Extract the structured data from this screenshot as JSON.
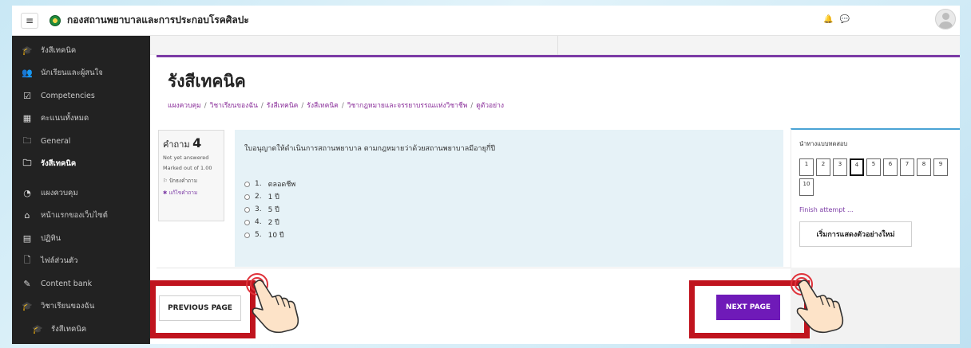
{
  "navbar": {
    "menu_icon": "hamburger-icon",
    "site_name": "กองสถานพยาบาลและการประกอบโรคศิลปะ",
    "notification_icon": "bell-icon",
    "message_icon": "chat-icon"
  },
  "sidebar": {
    "items": [
      {
        "label": "รังสีเทคนิค",
        "icon": "graduation-cap-icon"
      },
      {
        "label": "นักเรียนและผู้สนใจ",
        "icon": "users-icon"
      },
      {
        "label": "Competencies",
        "icon": "checkbox-icon"
      },
      {
        "label": "คะแนนทั้งหมด",
        "icon": "table-icon"
      },
      {
        "label": "General",
        "icon": "folder-icon"
      },
      {
        "label": "รังสีเทคนิค",
        "icon": "folder-icon"
      },
      {
        "label": "แผงควบคุม",
        "icon": "dashboard-icon"
      },
      {
        "label": "หน้าแรกของเว็บไซต์",
        "icon": "home-icon"
      },
      {
        "label": "ปฏิทิน",
        "icon": "calendar-icon"
      },
      {
        "label": "ไฟล์ส่วนตัว",
        "icon": "file-icon"
      },
      {
        "label": "Content bank",
        "icon": "pen-icon"
      },
      {
        "label": "วิชาเรียนของฉัน",
        "icon": "graduation-cap-icon"
      },
      {
        "label": "รังสีเทคนิค",
        "icon": "graduation-cap-icon"
      }
    ]
  },
  "page": {
    "title": "รังสีเทคนิค",
    "breadcrumb": [
      "แผงควบคุม",
      "วิชาเรียนของฉัน",
      "รังสีเทคนิค",
      "รังสีเทคนิค",
      "วิชากฎหมายและจรรยาบรรณแห่งวิชาชีพ",
      "ดูตัวอย่าง"
    ]
  },
  "question": {
    "label": "คำถาม",
    "number": "4",
    "status": "Not yet answered",
    "marked": "Marked out of 1.00",
    "flag_label": "ปักธงคำถาม",
    "edit_label": "แก้ไขคำถาม",
    "text": "ใบอนุญาตให้ดำเนินการสถานพยาบาล ตามกฎหมายว่าด้วยสถานพยาบาลมีอายุกี่ปี",
    "answers": [
      {
        "num": "1.",
        "text": "ตลอดชีพ"
      },
      {
        "num": "2.",
        "text": "1 ปี"
      },
      {
        "num": "3.",
        "text": "5 ปี"
      },
      {
        "num": "4.",
        "text": "2 ปี"
      },
      {
        "num": "5.",
        "text": "10 ปี"
      }
    ]
  },
  "quiz_nav": {
    "title": "นำทางแบบทดสอบ",
    "buttons": [
      "1",
      "2",
      "3",
      "4",
      "5",
      "6",
      "7",
      "8",
      "9",
      "10"
    ],
    "current": "4",
    "finish": "Finish attempt ...",
    "start_new": "เริ่มการแสดงตัวอย่างใหม่"
  },
  "buttons": {
    "previous": "PREVIOUS PAGE",
    "next": "NEXT PAGE"
  },
  "colors": {
    "accent": "#7b3aa5",
    "next_button": "#6f1ab8",
    "highlight": "#c0141e",
    "sidebar_bg": "#222222"
  }
}
